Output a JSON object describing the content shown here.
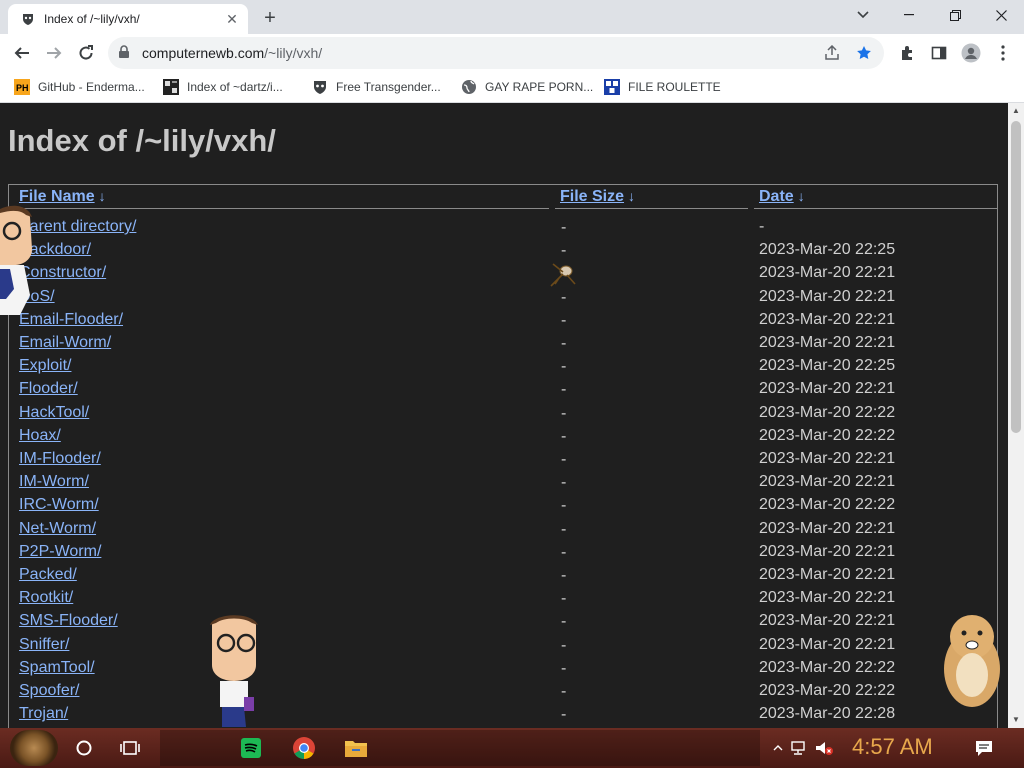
{
  "tab": {
    "title": "Index of /~lily/vxh/",
    "close": "✕",
    "new_tab": "+"
  },
  "window_controls": {
    "minimize": "—",
    "restore": "❐",
    "close": "✕",
    "tab_search": "⌄"
  },
  "address": {
    "host": "computernewb.com",
    "path": "/~lily/vxh/"
  },
  "bookmarks": [
    {
      "label": "GitHub - Enderma...",
      "icon": "ph-icon"
    },
    {
      "label": "Index of ~dartz/i...",
      "icon": "grid-icon"
    },
    {
      "label": "Free Transgender...",
      "icon": "mask-icon"
    },
    {
      "label": "GAY RAPE PORN...",
      "icon": "globe-icon"
    },
    {
      "label": "FILE ROULETTE",
      "icon": "roulette-icon"
    }
  ],
  "page": {
    "title": "Index of /~lily/vxh/",
    "columns": {
      "name": "File Name",
      "size": "File Size",
      "date": "Date",
      "sort_marker": "↓"
    },
    "rows": [
      {
        "name": "Parent directory/",
        "size": "-",
        "date": "-"
      },
      {
        "name": "Backdoor/",
        "size": "-",
        "date": "2023-Mar-20 22:25"
      },
      {
        "name": "Constructor/",
        "size": "-",
        "date": "2023-Mar-20 22:21"
      },
      {
        "name": "DoS/",
        "size": "-",
        "date": "2023-Mar-20 22:21"
      },
      {
        "name": "Email-Flooder/",
        "size": "-",
        "date": "2023-Mar-20 22:21"
      },
      {
        "name": "Email-Worm/",
        "size": "-",
        "date": "2023-Mar-20 22:21"
      },
      {
        "name": "Exploit/",
        "size": "-",
        "date": "2023-Mar-20 22:25"
      },
      {
        "name": "Flooder/",
        "size": "-",
        "date": "2023-Mar-20 22:21"
      },
      {
        "name": "HackTool/",
        "size": "-",
        "date": "2023-Mar-20 22:22"
      },
      {
        "name": "Hoax/",
        "size": "-",
        "date": "2023-Mar-20 22:22"
      },
      {
        "name": "IM-Flooder/",
        "size": "-",
        "date": "2023-Mar-20 22:21"
      },
      {
        "name": "IM-Worm/",
        "size": "-",
        "date": "2023-Mar-20 22:21"
      },
      {
        "name": "IRC-Worm/",
        "size": "-",
        "date": "2023-Mar-20 22:22"
      },
      {
        "name": "Net-Worm/",
        "size": "-",
        "date": "2023-Mar-20 22:21"
      },
      {
        "name": "P2P-Worm/",
        "size": "-",
        "date": "2023-Mar-20 22:21"
      },
      {
        "name": "Packed/",
        "size": "-",
        "date": "2023-Mar-20 22:21"
      },
      {
        "name": "Rootkit/",
        "size": "-",
        "date": "2023-Mar-20 22:21"
      },
      {
        "name": "SMS-Flooder/",
        "size": "-",
        "date": "2023-Mar-20 22:21"
      },
      {
        "name": "Sniffer/",
        "size": "-",
        "date": "2023-Mar-20 22:21"
      },
      {
        "name": "SpamTool/",
        "size": "-",
        "date": "2023-Mar-20 22:22"
      },
      {
        "name": "Spoofer/",
        "size": "-",
        "date": "2023-Mar-20 22:22"
      },
      {
        "name": "Trojan/",
        "size": "-",
        "date": "2023-Mar-20 22:28"
      }
    ]
  },
  "taskbar": {
    "clock": "4:57 AM"
  },
  "colors": {
    "link": "#8ab4f8",
    "page_bg": "#1f1f1f",
    "clock": "#e8a84c",
    "taskbar": "#5a2219",
    "star": "#1a73e8"
  }
}
